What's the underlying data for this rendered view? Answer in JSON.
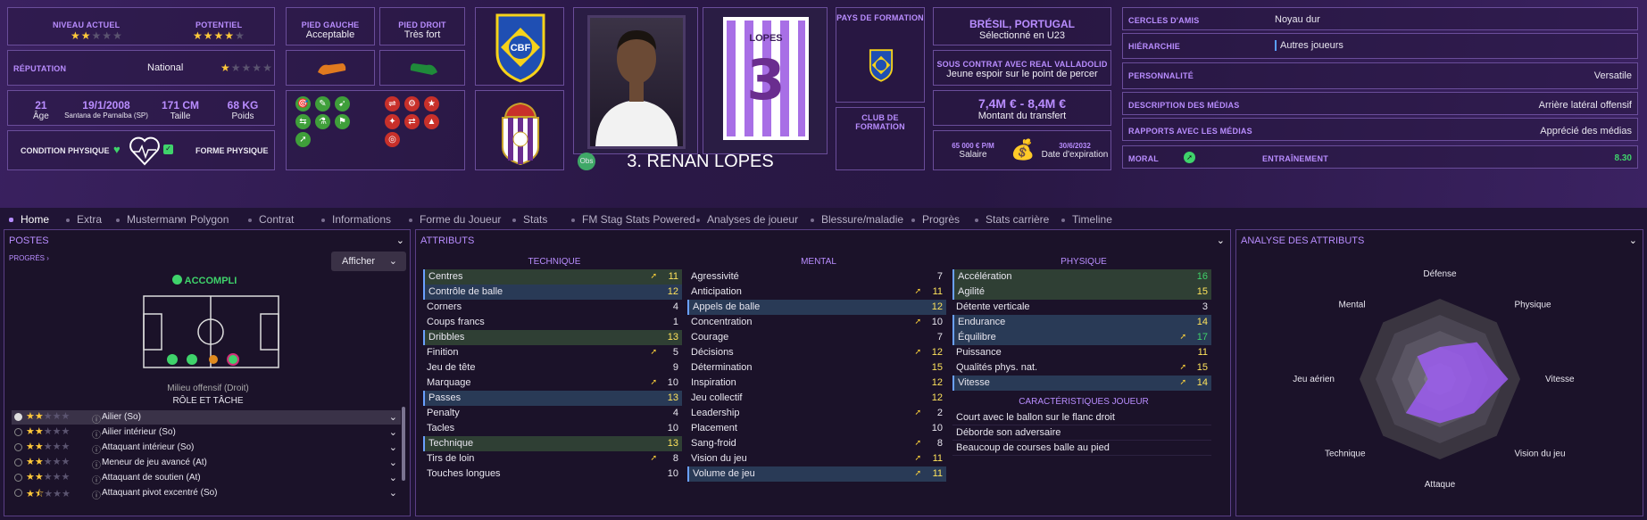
{
  "header": {
    "niveau_label": "NIVEAU ACTUEL",
    "niveau_stars": 2,
    "potentiel_label": "POTENTIEL",
    "potentiel_stars": 4,
    "reputation_label": "RÉPUTATION",
    "reputation_value": "National",
    "reputation_stars": 1,
    "age": "21",
    "age_label": "Âge",
    "birth": "19/1/2008",
    "birth_place": "Santana de Parnaíba (SP)",
    "height": "171 CM",
    "height_label": "Taille",
    "weight": "68 KG",
    "weight_label": "Poids",
    "condition_label": "CONDITION PHYSIQUE",
    "forme_label": "FORME PHYSIQUE",
    "pied_gauche_label": "PIED GAUCHE",
    "pied_gauche_value": "Acceptable",
    "pied_droit_label": "PIED DROIT",
    "pied_droit_value": "Très fort",
    "player_name": "3. RENAN LOPES",
    "obs_label": "Obs",
    "shirt_name": "LOPES",
    "shirt_number": "3",
    "pays_formation_label": "PAYS DE FORMATION",
    "club_formation_label": "CLUB DE FORMATION",
    "nation": "BRÉSIL, PORTUGAL",
    "nation_sub": "Sélectionné en U23",
    "contract_label": "SOUS CONTRAT AVEC REAL VALLADOLID",
    "contract_sub": "Jeune espoir sur le point de percer",
    "transfer_value": "7,4M € - 8,4M €",
    "transfer_label": "Montant du transfert",
    "salary": "65 000 € P/M",
    "salary_label": "Salaire",
    "expiry": "30/6/2032",
    "expiry_label": "Date d'expiration",
    "cbf_text": "CBF"
  },
  "right_info": [
    {
      "label": "CERCLES D'AMIS",
      "value": "Noyau dur"
    },
    {
      "label": "HIÉRARCHIE",
      "value": "Autres joueurs"
    },
    {
      "label": "PERSONNALITÉ",
      "value": "Versatile"
    },
    {
      "label": "DESCRIPTION DES MÉDIAS",
      "value": "Arrière latéral offensif"
    },
    {
      "label": "RAPPORTS AVEC LES MÉDIAS",
      "value": "Apprécié des médias"
    }
  ],
  "moral_label": "MORAL",
  "training_label": "ENTRAÎNEMENT",
  "training_value": "8.30",
  "tabs": [
    "Home",
    "Extra",
    "Mustermann",
    "Polygon",
    "Contrat",
    "Informations",
    "Forme du Joueur",
    "Stats",
    "FM Stag Stats Powered",
    "Analyses de joueur",
    "Blessure/maladie",
    "Progrès",
    "Stats carrière",
    "Timeline"
  ],
  "postes": {
    "title": "POSTES",
    "progres": "PROGRÈS",
    "afficher": "Afficher",
    "accompli": "ACCOMPLI",
    "position_name": "Milieu offensif (Droit)",
    "role_label": "RÔLE ET TÂCHE",
    "roles": [
      {
        "name": "Ailier (So)",
        "stars": 2,
        "half": false,
        "selected": true
      },
      {
        "name": "Ailier intérieur (So)",
        "stars": 2,
        "half": false,
        "selected": false
      },
      {
        "name": "Attaquant intérieur (So)",
        "stars": 2,
        "half": false,
        "selected": false
      },
      {
        "name": "Meneur de jeu avancé (At)",
        "stars": 2,
        "half": false,
        "selected": false
      },
      {
        "name": "Attaquant de soutien (At)",
        "stars": 2,
        "half": false,
        "selected": false
      },
      {
        "name": "Attaquant pivot excentré (So)",
        "stars": 1,
        "half": true,
        "selected": false
      }
    ]
  },
  "attributs": {
    "title": "ATTRIBUTS",
    "technique_label": "TECHNIQUE",
    "mental_label": "MENTAL",
    "physique_label": "PHYSIQUE",
    "technique": [
      {
        "name": "Centres",
        "value": "11",
        "hl": "green",
        "arrow": true
      },
      {
        "name": "Contrôle de balle",
        "value": "12",
        "hl": "blue",
        "arrow": false
      },
      {
        "name": "Corners",
        "value": "4",
        "hl": "",
        "arrow": false
      },
      {
        "name": "Coups francs",
        "value": "1",
        "hl": "",
        "arrow": false
      },
      {
        "name": "Dribbles",
        "value": "13",
        "hl": "green",
        "arrow": false
      },
      {
        "name": "Finition",
        "value": "5",
        "hl": "",
        "arrow": true
      },
      {
        "name": "Jeu de tête",
        "value": "9",
        "hl": "",
        "arrow": false
      },
      {
        "name": "Marquage",
        "value": "10",
        "hl": "",
        "arrow": true
      },
      {
        "name": "Passes",
        "value": "13",
        "hl": "blue",
        "arrow": false
      },
      {
        "name": "Penalty",
        "value": "4",
        "hl": "",
        "arrow": false
      },
      {
        "name": "Tacles",
        "value": "10",
        "hl": "",
        "arrow": false
      },
      {
        "name": "Technique",
        "value": "13",
        "hl": "green",
        "arrow": false
      },
      {
        "name": "Tirs de loin",
        "value": "8",
        "hl": "",
        "arrow": true
      },
      {
        "name": "Touches longues",
        "value": "10",
        "hl": "",
        "arrow": false
      }
    ],
    "mental": [
      {
        "name": "Agressivité",
        "value": "7",
        "hl": "",
        "arrow": false
      },
      {
        "name": "Anticipation",
        "value": "11",
        "hl": "",
        "arrow": true
      },
      {
        "name": "Appels de balle",
        "value": "12",
        "hl": "blue",
        "arrow": false
      },
      {
        "name": "Concentration",
        "value": "10",
        "hl": "",
        "arrow": true
      },
      {
        "name": "Courage",
        "value": "7",
        "hl": "",
        "arrow": false
      },
      {
        "name": "Décisions",
        "value": "12",
        "hl": "",
        "arrow": true
      },
      {
        "name": "Détermination",
        "value": "15",
        "hl": "",
        "arrow": false
      },
      {
        "name": "Inspiration",
        "value": "12",
        "hl": "",
        "arrow": false
      },
      {
        "name": "Jeu collectif",
        "value": "12",
        "hl": "",
        "arrow": false
      },
      {
        "name": "Leadership",
        "value": "2",
        "hl": "",
        "arrow": true
      },
      {
        "name": "Placement",
        "value": "10",
        "hl": "",
        "arrow": false
      },
      {
        "name": "Sang-froid",
        "value": "8",
        "hl": "",
        "arrow": true
      },
      {
        "name": "Vision du jeu",
        "value": "11",
        "hl": "",
        "arrow": true
      },
      {
        "name": "Volume de jeu",
        "value": "11",
        "hl": "blue",
        "arrow": true
      }
    ],
    "physique": [
      {
        "name": "Accélération",
        "value": "16",
        "hl": "green",
        "arrow": false
      },
      {
        "name": "Agilité",
        "value": "15",
        "hl": "green",
        "arrow": false
      },
      {
        "name": "Détente verticale",
        "value": "3",
        "hl": "",
        "arrow": false
      },
      {
        "name": "Endurance",
        "value": "14",
        "hl": "blue",
        "arrow": false
      },
      {
        "name": "Équilibre",
        "value": "17",
        "hl": "blue",
        "arrow": true
      },
      {
        "name": "Puissance",
        "value": "11",
        "hl": "",
        "arrow": false
      },
      {
        "name": "Qualités phys. nat.",
        "value": "15",
        "hl": "",
        "arrow": true
      },
      {
        "name": "Vitesse",
        "value": "14",
        "hl": "blue",
        "arrow": true
      }
    ],
    "traits_label": "CARACTÉRISTIQUES JOUEUR",
    "traits": [
      "Court avec le ballon sur le flanc droit",
      "Déborde son adversaire",
      "Beaucoup de courses balle au pied"
    ]
  },
  "analyse": {
    "title": "ANALYSE DES ATTRIBUTS",
    "axes": [
      "Défense",
      "Physique",
      "Vitesse",
      "Vision du jeu",
      "Attaque",
      "Technique",
      "Jeu aérien",
      "Mental"
    ],
    "values": [
      0.4,
      0.65,
      0.85,
      0.6,
      0.55,
      0.6,
      0.15,
      0.4
    ],
    "color": "#9b5cf0"
  }
}
